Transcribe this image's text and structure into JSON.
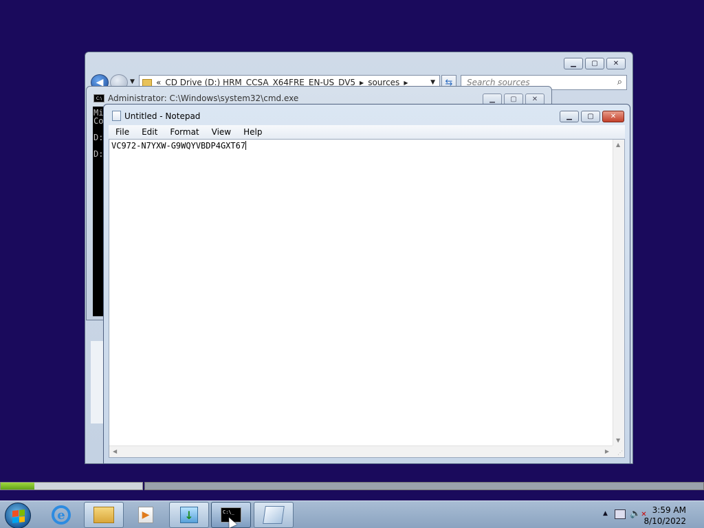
{
  "explorer": {
    "breadcrumb_prefix": "«",
    "breadcrumb_drive": "CD Drive (D:) HRM_CCSA_X64FRE_EN-US_DV5",
    "breadcrumb_folder": "sources",
    "search_placeholder": "Search sources"
  },
  "cmd": {
    "title": "Administrator: C:\\Windows\\system32\\cmd.exe",
    "console_text": "Mi\nCo\n\nD:\n\nD:"
  },
  "notepad": {
    "title": "Untitled - Notepad",
    "menu": [
      "File",
      "Edit",
      "Format",
      "View",
      "Help"
    ],
    "content": "VC972-N7YXW-G9WQYVBDP4GXT67"
  },
  "progress": {
    "value": 0.24
  },
  "taskbar": {
    "items": [
      "start-orb",
      "internet-explorer",
      "windows-explorer",
      "media-player",
      "installer",
      "command-prompt",
      "notepad"
    ]
  },
  "clock": {
    "time": "3:59 AM",
    "date": "8/10/2022"
  },
  "colors": {
    "desktop": "#1a0a5c",
    "progress_fill": "#62a21a"
  }
}
